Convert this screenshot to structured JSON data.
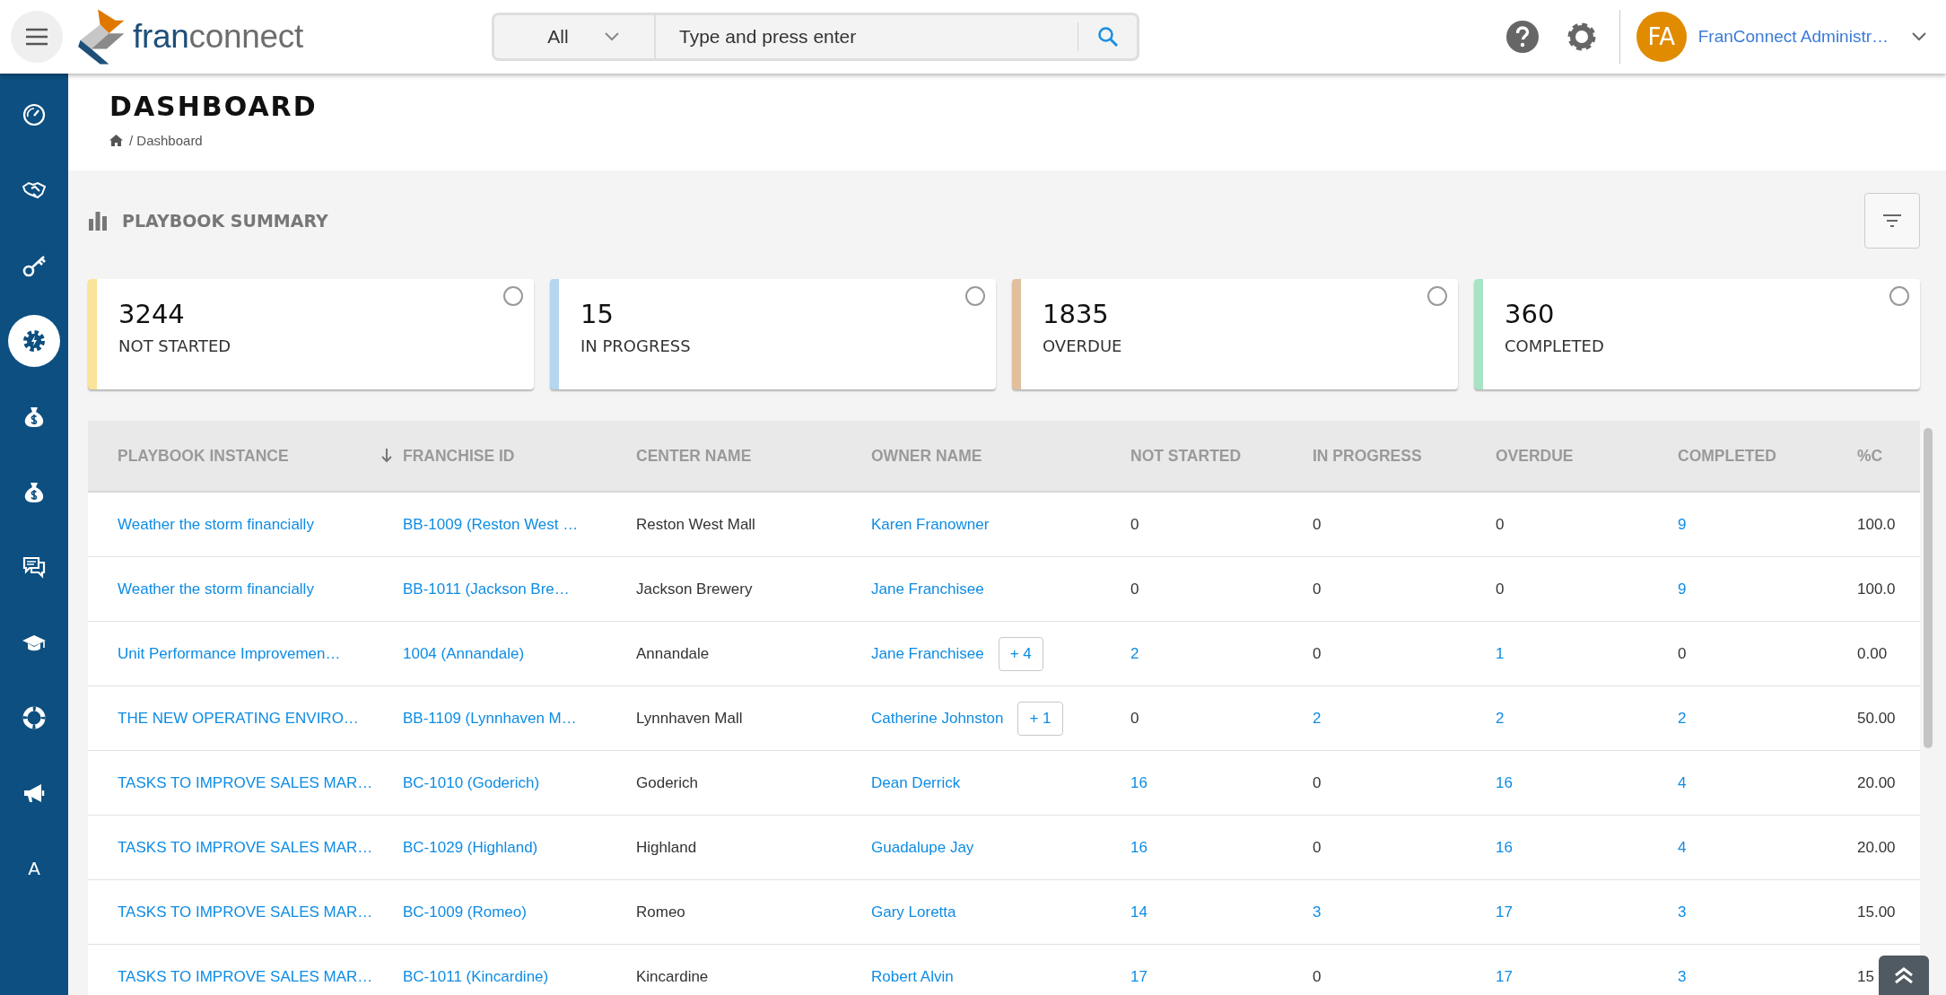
{
  "topbar": {
    "logo": {
      "parts": [
        "fran",
        "connect"
      ]
    },
    "search": {
      "scope": "All",
      "placeholder": "Type and press enter"
    },
    "user": {
      "initials": "FA",
      "name": "FranConnect Administr…"
    }
  },
  "sidebar": {
    "items": [
      {
        "selected": false
      },
      {
        "selected": false
      },
      {
        "selected": false
      },
      {
        "selected": true
      },
      {
        "selected": false
      },
      {
        "selected": false
      },
      {
        "selected": false
      },
      {
        "selected": false
      },
      {
        "selected": false
      },
      {
        "selected": false
      },
      {
        "text": "A",
        "selected": false
      }
    ]
  },
  "page": {
    "title": "DASHBOARD",
    "breadcrumb": "/ Dashboard"
  },
  "summary": {
    "title": "PLAYBOOK SUMMARY",
    "cards": [
      {
        "value": "3244",
        "label": "NOT STARTED",
        "color": "#f9e49a",
        "selected": false
      },
      {
        "value": "15",
        "label": "IN PROGRESS",
        "color": "#b4d6ee",
        "selected": false
      },
      {
        "value": "1835",
        "label": "OVERDUE",
        "color": "#e0bf9d",
        "selected": false
      },
      {
        "value": "360",
        "label": "COMPLETED",
        "color": "#a7e3c4",
        "selected": false
      }
    ]
  },
  "table": {
    "columns": [
      {
        "label": "PLAYBOOK INSTANCE",
        "sorted": true
      },
      {
        "label": "FRANCHISE ID",
        "sorted": false
      },
      {
        "label": "CENTER NAME",
        "sorted": false
      },
      {
        "label": "OWNER NAME",
        "sorted": false
      },
      {
        "label": "NOT STARTED",
        "sorted": false
      },
      {
        "label": "IN PROGRESS",
        "sorted": false
      },
      {
        "label": "OVERDUE",
        "sorted": false
      },
      {
        "label": "COMPLETED",
        "sorted": false
      },
      {
        "label": "%C",
        "sorted": false
      }
    ],
    "rows": [
      {
        "instance": "Weather the storm financially",
        "franchise_id": "BB-1009 (Reston West …",
        "center": "Reston West Mall",
        "owner": "Karen Franowner",
        "counts": [
          {
            "text": "0",
            "link": false
          },
          {
            "text": "0",
            "link": false
          },
          {
            "text": "0",
            "link": false
          },
          {
            "text": "9",
            "link": true
          }
        ],
        "percent": "100.0"
      },
      {
        "instance": "Weather the storm financially",
        "franchise_id": "BB-1011 (Jackson Bre…",
        "center": "Jackson Brewery",
        "owner": "Jane Franchisee",
        "counts": [
          {
            "text": "0",
            "link": false
          },
          {
            "text": "0",
            "link": false
          },
          {
            "text": "0",
            "link": false
          },
          {
            "text": "9",
            "link": true
          }
        ],
        "percent": "100.0"
      },
      {
        "instance": "Unit Performance Improvemen…",
        "franchise_id": "1004 (Annandale)",
        "center": "Annandale",
        "owner": "Jane Franchisee",
        "more_owners": "+ 4",
        "counts": [
          {
            "text": "2",
            "link": true
          },
          {
            "text": "0",
            "link": false
          },
          {
            "text": "1",
            "link": true
          },
          {
            "text": "0",
            "link": false
          }
        ],
        "percent": "0.00"
      },
      {
        "instance": "THE NEW OPERATING ENVIRO…",
        "franchise_id": "BB-1109 (Lynnhaven M…",
        "center": "Lynnhaven Mall",
        "owner": "Catherine Johnston",
        "more_owners": "+ 1",
        "counts": [
          {
            "text": "0",
            "link": false
          },
          {
            "text": "2",
            "link": true
          },
          {
            "text": "2",
            "link": true
          },
          {
            "text": "2",
            "link": true
          }
        ],
        "percent": "50.00"
      },
      {
        "instance": "TASKS TO IMPROVE SALES MAR…",
        "franchise_id": "BC-1010 (Goderich)",
        "center": "Goderich",
        "owner": "Dean Derrick",
        "counts": [
          {
            "text": "16",
            "link": true
          },
          {
            "text": "0",
            "link": false
          },
          {
            "text": "16",
            "link": true
          },
          {
            "text": "4",
            "link": true
          }
        ],
        "percent": "20.00"
      },
      {
        "instance": "TASKS TO IMPROVE SALES MAR…",
        "franchise_id": "BC-1029 (Highland)",
        "center": "Highland",
        "owner": "Guadalupe Jay",
        "counts": [
          {
            "text": "16",
            "link": true
          },
          {
            "text": "0",
            "link": false
          },
          {
            "text": "16",
            "link": true
          },
          {
            "text": "4",
            "link": true
          }
        ],
        "percent": "20.00"
      },
      {
        "instance": "TASKS TO IMPROVE SALES MAR…",
        "franchise_id": "BC-1009 (Romeo)",
        "center": "Romeo",
        "owner": "Gary Loretta",
        "counts": [
          {
            "text": "14",
            "link": true
          },
          {
            "text": "3",
            "link": true
          },
          {
            "text": "17",
            "link": true
          },
          {
            "text": "3",
            "link": true
          }
        ],
        "percent": "15.00"
      },
      {
        "instance": "TASKS TO IMPROVE SALES MAR…",
        "franchise_id": "BC-1011 (Kincardine)",
        "center": "Kincardine",
        "owner": "Robert Alvin",
        "counts": [
          {
            "text": "17",
            "link": true
          },
          {
            "text": "0",
            "link": false
          },
          {
            "text": "17",
            "link": true
          },
          {
            "text": "3",
            "link": true
          }
        ],
        "percent": "15"
      }
    ]
  }
}
